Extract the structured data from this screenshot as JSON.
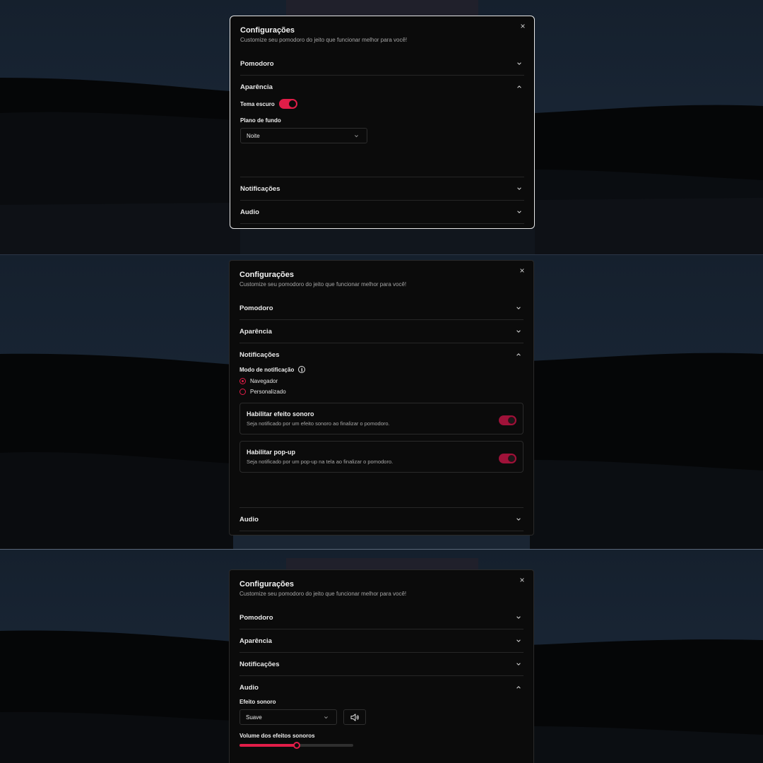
{
  "dialog": {
    "title": "Configurações",
    "subtitle": "Customize seu pomodoro do jeito que funcionar melhor para você!",
    "close_icon": "×"
  },
  "sections": {
    "pomodoro": "Pomodoro",
    "aparencia": "Aparência",
    "notificacoes": "Notificações",
    "audio": "Audio"
  },
  "appearance": {
    "dark_theme_label": "Tema escuro",
    "dark_theme_on": true,
    "background_label": "Plano de fundo",
    "background_value": "Noite"
  },
  "notifications": {
    "mode_label": "Modo de notificação",
    "info_icon": "i",
    "options": [
      "Navegador",
      "Personalizado"
    ],
    "selected": "Navegador",
    "sound_title": "Habilitar efeito sonoro",
    "sound_desc": "Seja notificado por um efeito sonoro ao finalizar o pomodoro.",
    "sound_on": true,
    "popup_title": "Habilitar pop-up",
    "popup_desc": "Seja notificado por um pop-up na tela ao finalizar o pomodoro.",
    "popup_on": true
  },
  "audio": {
    "effect_label": "Efeito sonoro",
    "effect_value": "Suave",
    "volume_label": "Volume dos efeitos sonoros",
    "volume": 0.5
  },
  "colors": {
    "accent": "#e11d48",
    "dialog_bg": "#0b0b0b"
  }
}
